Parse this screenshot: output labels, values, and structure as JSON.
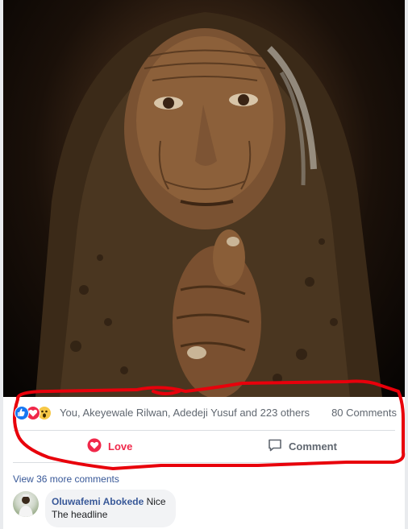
{
  "post": {
    "photo_alt": "",
    "reactions": {
      "icons": [
        "like-icon",
        "love-icon",
        "wow-icon"
      ],
      "summary": "You, Akeyewale Rilwan, Adedeji Yusuf and 223 others",
      "comments_count": "80 Comments"
    },
    "actions": {
      "love_label": "Love",
      "comment_label": "Comment"
    },
    "view_more": "View 36 more comments",
    "comments": [
      {
        "author": "Oluwafemi Abokede",
        "text_line1": "Nice",
        "text_line2": "The headline"
      }
    ]
  },
  "colors": {
    "love_red": "#f0284a",
    "like_blue": "#1877f2",
    "wow_yellow": "#f7c846",
    "link_blue": "#385898",
    "meta_gray": "#606770",
    "annotation_red": "#e8000b"
  }
}
